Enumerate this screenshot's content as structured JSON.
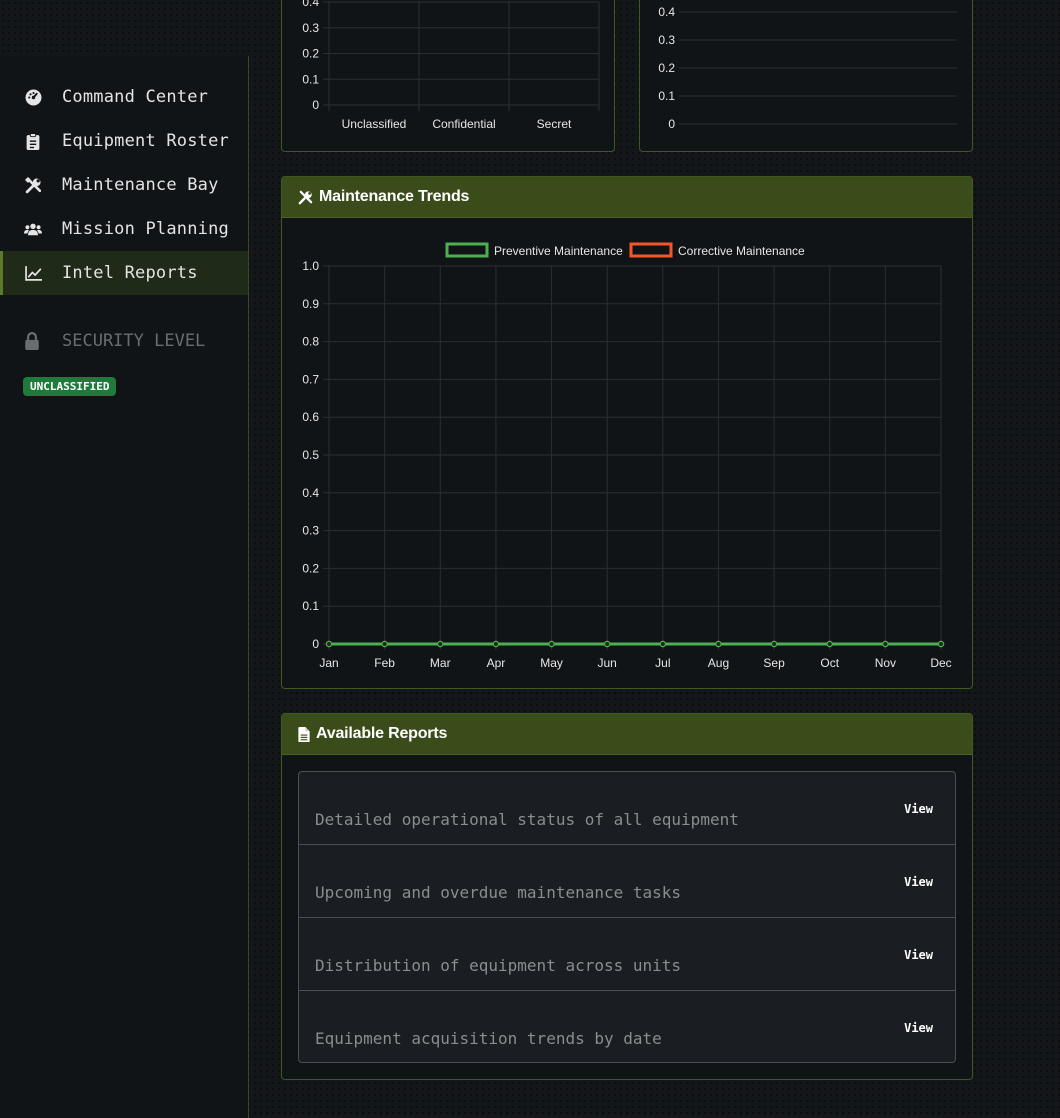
{
  "sidebar": {
    "items": [
      {
        "label": "Command Center",
        "icon": "dashboard-gauge-icon",
        "active": false
      },
      {
        "label": "Equipment Roster",
        "icon": "clipboard-list-icon",
        "active": false
      },
      {
        "label": "Maintenance Bay",
        "icon": "tools-icon",
        "active": false
      },
      {
        "label": "Mission Planning",
        "icon": "users-group-icon",
        "active": false
      },
      {
        "label": "Intel Reports",
        "icon": "chart-line-icon",
        "active": true
      }
    ],
    "security_label": "SECURITY LEVEL",
    "security_icon": "lock-icon",
    "security_badge": "UNCLASSIFIED"
  },
  "colors": {
    "accent": "#5b7a2b",
    "header_bg": "#3b4c1b",
    "badge_green": "#1f7a3c",
    "preventive": "#4caf50",
    "corrective": "#f2572c"
  },
  "chart_data": [
    {
      "type": "bar",
      "categories": [
        "Unclassified",
        "Confidential",
        "Secret"
      ],
      "values": [
        0,
        0,
        0
      ],
      "ylim": [
        0,
        0.4
      ],
      "yticks": [
        "0",
        "0.1",
        "0.2",
        "0.3",
        "0.4"
      ],
      "grid": true
    },
    {
      "type": "bar",
      "categories": [],
      "values": [],
      "ylim": [
        0,
        0.4
      ],
      "yticks": [
        "0",
        "0.1",
        "0.2",
        "0.3",
        "0.4"
      ],
      "grid": true
    },
    {
      "type": "line",
      "title": "Maintenance Trends",
      "title_icon": "tools-icon",
      "categories": [
        "Jan",
        "Feb",
        "Mar",
        "Apr",
        "May",
        "Jun",
        "Jul",
        "Aug",
        "Sep",
        "Oct",
        "Nov",
        "Dec"
      ],
      "series": [
        {
          "name": "Preventive Maintenance",
          "color": "#4caf50",
          "values": [
            0,
            0,
            0,
            0,
            0,
            0,
            0,
            0,
            0,
            0,
            0,
            0
          ]
        },
        {
          "name": "Corrective Maintenance",
          "color": "#f2572c",
          "values": [
            0,
            0,
            0,
            0,
            0,
            0,
            0,
            0,
            0,
            0,
            0,
            0
          ]
        }
      ],
      "ylim": [
        0,
        1.0
      ],
      "yticks": [
        "0",
        "0.1",
        "0.2",
        "0.3",
        "0.4",
        "0.5",
        "0.6",
        "0.7",
        "0.8",
        "0.9",
        "1.0"
      ],
      "grid": true,
      "legend": "top"
    }
  ],
  "reports": {
    "title": "Available Reports",
    "title_icon": "file-document-icon",
    "items": [
      {
        "description": "Detailed operational status of all equipment",
        "action": "View"
      },
      {
        "description": "Upcoming and overdue maintenance tasks",
        "action": "View"
      },
      {
        "description": "Distribution of equipment across units",
        "action": "View"
      },
      {
        "description": "Equipment acquisition trends by date",
        "action": "View"
      }
    ]
  }
}
